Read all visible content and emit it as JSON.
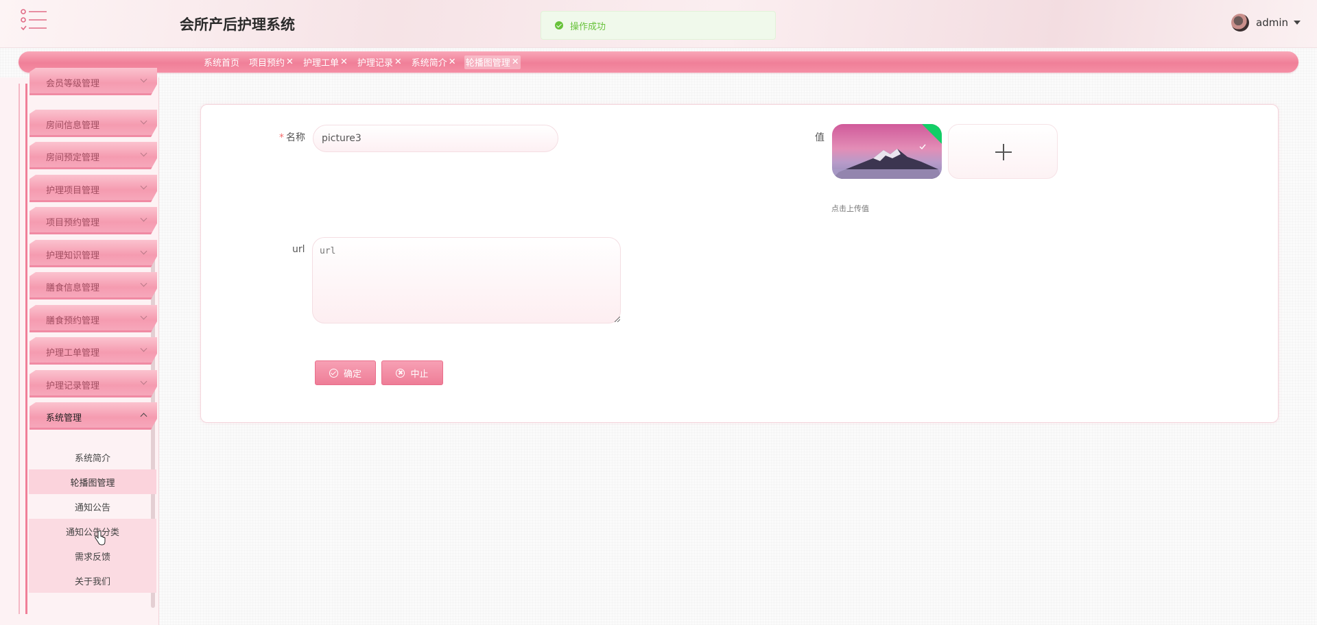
{
  "app_title": "会所产后护理系统",
  "toast": {
    "message": "操作成功",
    "type": "success"
  },
  "user": {
    "name": "admin"
  },
  "tabs": [
    {
      "label": "系统首页",
      "closable": false,
      "active": false
    },
    {
      "label": "项目预约",
      "closable": true,
      "active": false
    },
    {
      "label": "护理工单",
      "closable": true,
      "active": false
    },
    {
      "label": "护理记录",
      "closable": true,
      "active": false
    },
    {
      "label": "系统简介",
      "closable": true,
      "active": false
    },
    {
      "label": "轮播图管理",
      "closable": true,
      "active": true
    }
  ],
  "sidebar": {
    "menus": [
      {
        "label": "会员等级管理",
        "open": false
      },
      {
        "label": "房间信息管理",
        "open": false
      },
      {
        "label": "房间预定管理",
        "open": false
      },
      {
        "label": "护理项目管理",
        "open": false
      },
      {
        "label": "项目预约管理",
        "open": false
      },
      {
        "label": "护理知识管理",
        "open": false
      },
      {
        "label": "膳食信息管理",
        "open": false
      },
      {
        "label": "膳食预约管理",
        "open": false
      },
      {
        "label": "护理工单管理",
        "open": false
      },
      {
        "label": "护理记录管理",
        "open": false
      },
      {
        "label": "系统管理",
        "open": true
      }
    ],
    "submenu": [
      {
        "label": "系统简介",
        "active": false
      },
      {
        "label": "轮播图管理",
        "active": true
      },
      {
        "label": "通知公告",
        "active": false
      },
      {
        "label": "通知公告分类",
        "active": false
      },
      {
        "label": "需求反馈",
        "active": false
      },
      {
        "label": "关于我们",
        "active": false
      }
    ]
  },
  "form": {
    "name_label": "名称",
    "name_value": "picture3",
    "value_label": "值",
    "upload_tip": "点击上传值",
    "url_label": "url",
    "url_placeholder": "url",
    "url_value": ""
  },
  "buttons": {
    "confirm": "确定",
    "cancel": "中止"
  },
  "colors": {
    "accent": "#f07f98",
    "accent_light": "#f9a7b8",
    "success": "#67c23a",
    "upload_check": "#13ce66"
  },
  "icons": {
    "menu_toggle": "menu-list-icon",
    "toast": "check-circle-icon",
    "caret": "caret-down-icon",
    "tab_close": "close-icon",
    "submenu_chevron": "chevron-down-icon",
    "upload": "plus-icon",
    "confirm": "check-circle-icon",
    "cancel": "close-circle-icon"
  }
}
